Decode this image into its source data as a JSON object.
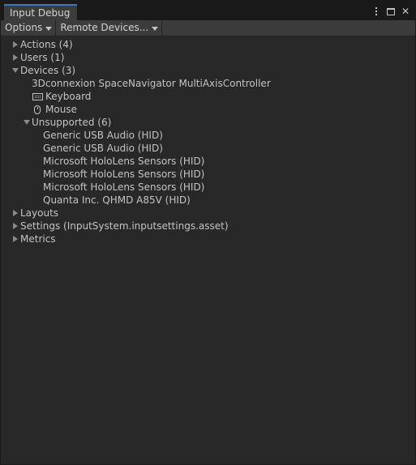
{
  "window": {
    "tab_title": "Input Debug",
    "controls": {
      "menu_icon": "kebab-menu-icon",
      "maximize_icon": "maximize-icon",
      "close_icon": "close-icon",
      "close_glyph": "✕"
    }
  },
  "toolbar": {
    "options_label": "Options",
    "remote_devices_label": "Remote Devices..."
  },
  "tree": {
    "actions": {
      "label": "Actions (4)",
      "expanded": false
    },
    "users": {
      "label": "Users (1)",
      "expanded": false
    },
    "devices": {
      "label": "Devices (3)",
      "expanded": true,
      "items": [
        {
          "label": "3Dconnexion SpaceNavigator MultiAxisController",
          "icon": ""
        },
        {
          "label": "Keyboard",
          "icon": "keyboard-icon"
        },
        {
          "label": "Mouse",
          "icon": "mouse-icon"
        }
      ],
      "unsupported": {
        "label": "Unsupported (6)",
        "expanded": true,
        "items": [
          "Generic USB Audio (HID)",
          "Generic USB Audio (HID)",
          "Microsoft HoloLens Sensors (HID)",
          "Microsoft HoloLens Sensors (HID)",
          "Microsoft HoloLens Sensors (HID)",
          "Quanta Inc. QHMD A85V (HID)"
        ]
      }
    },
    "layouts": {
      "label": "Layouts",
      "expanded": false
    },
    "settings": {
      "label": "Settings (InputSystem.inputsettings.asset)",
      "expanded": false
    },
    "metrics": {
      "label": "Metrics",
      "expanded": false
    }
  },
  "colors": {
    "window_bg": "#282828",
    "titlebar_bg": "#191919",
    "tab_bg": "#3c3c3c",
    "tab_accent": "#3a79bb",
    "toolbar_bg": "#3c3c3c",
    "text": "#c4c4c4",
    "foldout_arrow": "#8a8a8a"
  }
}
